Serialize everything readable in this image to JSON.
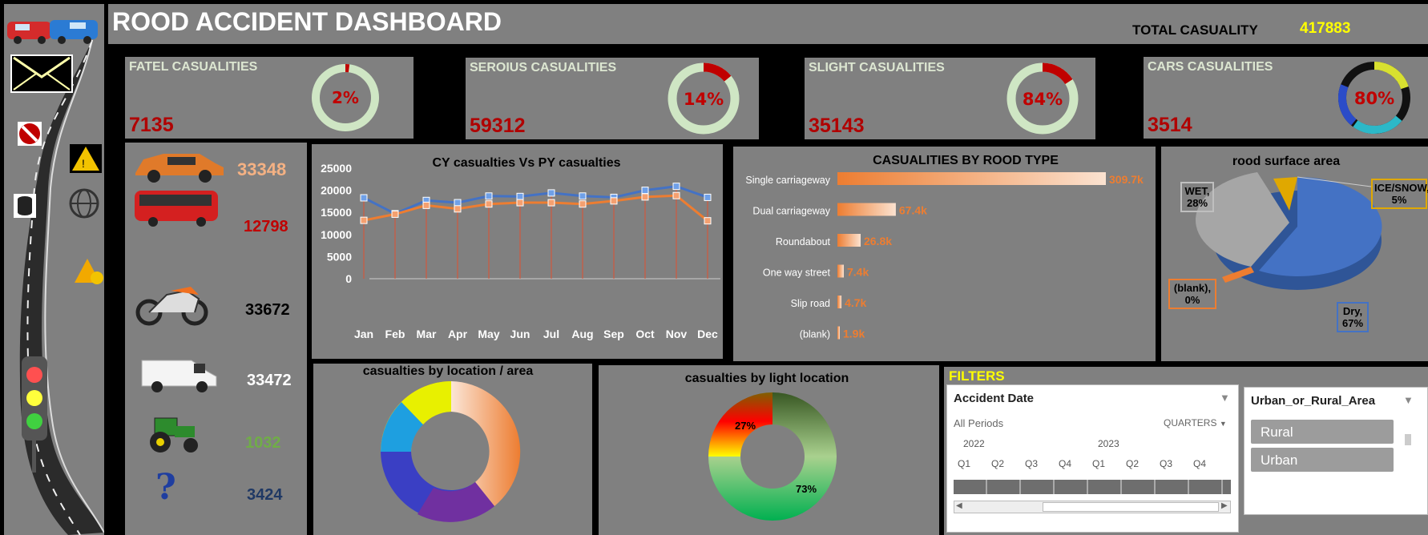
{
  "header": {
    "title": "ROOD ACCIDENT DASHBOARD",
    "total_label": "TOTAL CASUALITY",
    "total_value": "417883"
  },
  "kpis": [
    {
      "title": "FATEL CASUALITIES",
      "value": "7135",
      "pct_label": "2%",
      "pct": 0.02
    },
    {
      "title": "SEROIUS CASUALITIES",
      "value": "59312",
      "pct_label": "14%",
      "pct": 0.14
    },
    {
      "title": "SLIGHT CASUALITIES",
      "value": "35143",
      "pct_label": "84%",
      "pct": 0.84
    },
    {
      "title": "CARS CASUALITIES",
      "value": "3514",
      "pct_label": "80%",
      "pct": 0.8
    }
  ],
  "vehicles": [
    {
      "name": "car-icon",
      "value": "33348",
      "color": "#f4b183"
    },
    {
      "name": "bus-icon",
      "value": "12798",
      "color": "#c00000"
    },
    {
      "name": "motorcycle-icon",
      "value": "33672",
      "color": "#000000"
    },
    {
      "name": "van-icon",
      "value": "33472",
      "color": "#ffffff"
    },
    {
      "name": "tractor-icon",
      "value": "1032",
      "color": "#70ad47"
    },
    {
      "name": "question-icon",
      "value": "3424",
      "color": "#1f3864"
    }
  ],
  "sidebar_icons": [
    "envelope-icon",
    "no-entry-icon",
    "slippery-road-icon",
    "database-icon",
    "globe-icon",
    "construction-icon",
    "traffic-light-icon"
  ],
  "chart_data": [
    {
      "type": "line",
      "title": "CY casualties Vs PY casualties",
      "categories": [
        "Jan",
        "Feb",
        "Mar",
        "Apr",
        "May",
        "Jun",
        "Jul",
        "Aug",
        "Sep",
        "Oct",
        "Nov",
        "Dec"
      ],
      "ylim": [
        0,
        25000
      ],
      "yticks": [
        "25000",
        "20000",
        "15000",
        "10000",
        "5000",
        "0"
      ],
      "series": [
        {
          "values": [
            18300,
            14700,
            17700,
            17200,
            18700,
            18600,
            19400,
            18700,
            18400,
            20000,
            20900,
            18400
          ],
          "color": "#4472c4"
        },
        {
          "values": [
            13200,
            14600,
            16600,
            15800,
            16900,
            17200,
            17200,
            16900,
            17600,
            18500,
            18800,
            13100
          ],
          "color": "#ed7d31"
        }
      ]
    },
    {
      "type": "bar",
      "title": "CASUALITIES BY ROOD TYPE",
      "categories": [
        "Single carriageway",
        "Dual carriageway",
        "Roundabout",
        "One way street",
        "Slip road",
        "(blank)"
      ],
      "values": [
        309700,
        67400,
        26800,
        7400,
        4700,
        1900
      ],
      "labels": [
        "309.7k",
        "67.4k",
        "26.8k",
        "7.4k",
        "4.7k",
        "1.9k"
      ]
    },
    {
      "type": "pie",
      "title": "rood surface area",
      "categories": [
        "Dry, 67%",
        "WET, 28%",
        "ICE/SNOW, 5%",
        "(blank), 0%"
      ],
      "values": [
        67,
        28,
        5,
        0.5
      ]
    },
    {
      "type": "pie",
      "title": "casualties by location / area",
      "values": [
        60,
        40
      ]
    },
    {
      "type": "pie",
      "title": "casualties by  light location",
      "labels": [
        "27%",
        "73%"
      ],
      "values": [
        27,
        73
      ]
    }
  ],
  "filters": {
    "title": "FILTERS",
    "date_slicer": {
      "title": "Accident Date",
      "period": "All Periods",
      "granularity": "QUARTERS",
      "years": [
        "2022",
        "2023"
      ],
      "quarters": [
        "Q1",
        "Q2",
        "Q3",
        "Q4",
        "Q1",
        "Q2",
        "Q3",
        "Q4"
      ]
    },
    "area_slicer": {
      "title": "Urban_or_Rural_Area",
      "items": [
        "Rural",
        "Urban"
      ]
    }
  }
}
